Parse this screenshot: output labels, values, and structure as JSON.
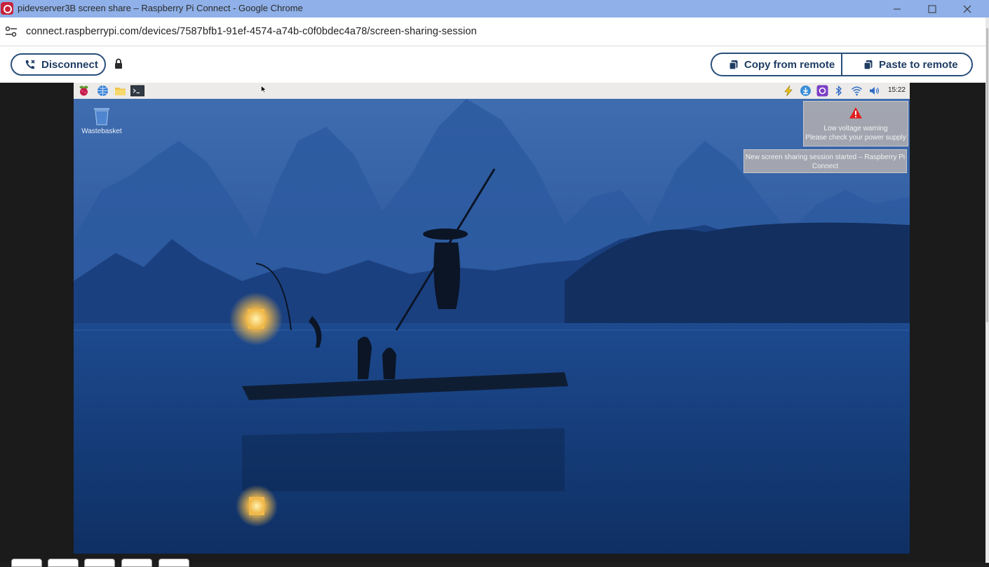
{
  "window": {
    "title": "pidevserver3B screen share – Raspberry Pi Connect - Google Chrome",
    "minimize_icon": "minimize-icon",
    "maximize_icon": "maximize-icon",
    "close_icon": "close-icon"
  },
  "address_bar": {
    "url": "connect.raspberrypi.com/devices/7587bfb1-91ef-4574-a74b-c0f0bdec4a78/screen-sharing-session",
    "site_icon": "site-settings-icon"
  },
  "toolbar": {
    "disconnect_label": "Disconnect",
    "disconnect_icon": "phone-disconnect-icon",
    "lock_icon": "lock-icon",
    "copy_label": "Copy from remote",
    "paste_label": "Paste to remote",
    "accent": "#2a4f7c"
  },
  "remote_desktop": {
    "taskbar": {
      "launchers": [
        "raspberry-menu-icon",
        "web-browser-icon",
        "file-manager-icon",
        "terminal-icon"
      ],
      "tray": [
        "low-voltage-icon",
        "updater-icon",
        "connect-icon",
        "bluetooth-icon",
        "wifi-icon",
        "volume-icon"
      ],
      "clock": "15:22"
    },
    "desktop_icons": [
      {
        "label": "Wastebasket",
        "icon": "wastebasket-icon"
      }
    ],
    "notifications": [
      {
        "icon": "warning-icon",
        "line1": "Low voltage warning",
        "line2": "Please check your power supply"
      },
      {
        "text": "New screen sharing session started – Raspberry Pi Connect"
      }
    ]
  }
}
